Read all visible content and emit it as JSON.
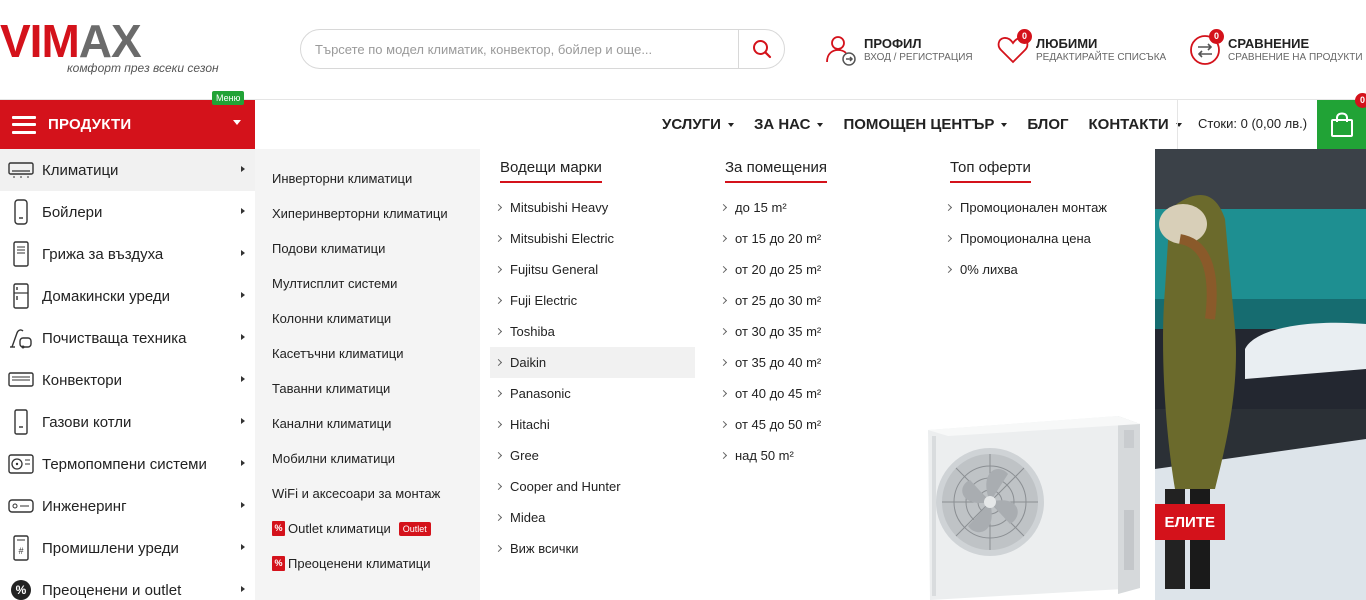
{
  "brand": {
    "logo_text_red": "VIM",
    "logo_text_grey": "AX",
    "tagline": "комфорт през всеки сезон",
    "accent": "#d4121b",
    "green": "#21a336"
  },
  "search": {
    "placeholder": "Търсете по модел климатик, конвектор, бойлер и още..."
  },
  "header": {
    "profile": {
      "title": "ПРОФИЛ",
      "sub": "ВХОД / РЕГИСТРАЦИЯ",
      "icon": "user-icon"
    },
    "favorites": {
      "title": "ЛЮБИМИ",
      "sub": "РЕДАКТИРАЙТЕ СПИСЪКА",
      "badge": "0",
      "icon": "heart-icon"
    },
    "compare": {
      "title": "СРАВНЕНИЕ",
      "sub": "СРАВНЕНИЕ НА ПРОДУКТИ",
      "badge": "0",
      "icon": "compare-icon"
    }
  },
  "nav": {
    "products_label": "ПРОДУКТИ",
    "menu_tag": "Меню",
    "links": [
      "УСЛУГИ",
      "ЗА НАС",
      "ПОМОЩЕН ЦЕНТЪР",
      "БЛОГ",
      "КОНТАКТИ"
    ],
    "cart_text": "Стоки: 0 (0,00 лв.)",
    "cart_badge": "0"
  },
  "sidebar": {
    "items": [
      {
        "label": "Климатици",
        "icon": "ac-icon"
      },
      {
        "label": "Бойлери",
        "icon": "boiler-icon"
      },
      {
        "label": "Грижа за въздуха",
        "icon": "air-purifier-icon"
      },
      {
        "label": "Домакински уреди",
        "icon": "fridge-icon"
      },
      {
        "label": "Почистваща техника",
        "icon": "vacuum-icon"
      },
      {
        "label": "Конвектори",
        "icon": "convector-icon"
      },
      {
        "label": "Газови котли",
        "icon": "gas-boiler-icon"
      },
      {
        "label": "Термопомпени системи",
        "icon": "heat-pump-icon"
      },
      {
        "label": "Инженеринг",
        "icon": "engineering-icon"
      },
      {
        "label": "Промишлени уреди",
        "icon": "industrial-icon"
      },
      {
        "label": "Преоценени и outlet",
        "icon": "percent-icon"
      }
    ]
  },
  "submenu": {
    "items": [
      "Инверторни климатици",
      "Хиперинверторни климатици",
      "Подови климатици",
      "Мултисплит системи",
      "Колонни климатици",
      "Касетъчни климатици",
      "Таванни климатици",
      "Канални климатици",
      "Мобилни климатици",
      "WiFi и аксесоари за монтаж"
    ],
    "outlet_label": "Outlet климатици",
    "outlet_badge": "Outlet",
    "repriced_label": "Преоценени климатици",
    "pct_glyph": "%"
  },
  "columns": {
    "brands": {
      "title": "Водещи марки",
      "items": [
        "Mitsubishi Heavy",
        "Mitsubishi Electric",
        "Fujitsu General",
        "Fuji Electric",
        "Toshiba",
        "Daikin",
        "Panasonic",
        "Hitachi",
        "Gree",
        "Cooper and Hunter",
        "Midea",
        "Виж всички"
      ]
    },
    "rooms": {
      "title": "За помещения",
      "items": [
        "до 15 m²",
        "от 15 до 20 m²",
        "от 20 до 25 m²",
        "от 25 до 30 m²",
        "от 30 до 35 m²",
        "от 35 до 40 m²",
        "от 40 до 45 m²",
        "от 45 до 50 m²",
        "над 50 m²"
      ]
    },
    "offers": {
      "title": "Топ оферти",
      "items": [
        "Промоционален монтаж",
        "Промоционална цена",
        "0% лихва"
      ]
    }
  },
  "hero": {
    "cta_label": "ЕЛИТЕ"
  }
}
